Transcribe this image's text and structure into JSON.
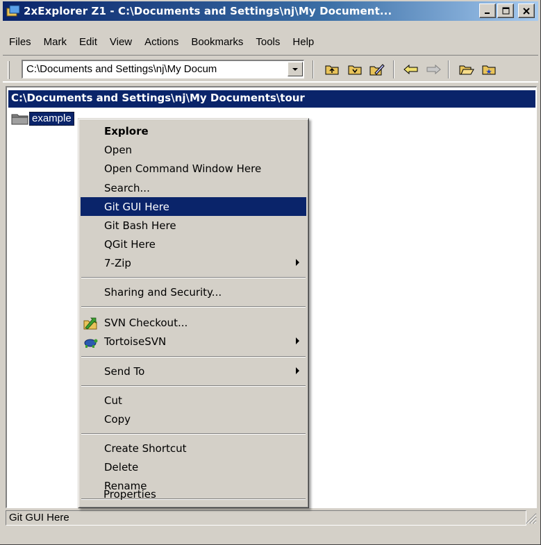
{
  "window": {
    "title": "2xExplorer Z1 - C:\\Documents and Settings\\nj\\My Document...",
    "app_icon": "2xexplorer-app-icon"
  },
  "menubar": {
    "items": [
      "Files",
      "Mark",
      "Edit",
      "View",
      "Actions",
      "Bookmarks",
      "Tools",
      "Help"
    ]
  },
  "toolbar": {
    "path_value": "C:\\Documents and Settings\\nj\\My Docum",
    "icons": [
      "up-folder-icon",
      "root-folder-icon",
      "edit-folder-icon",
      "back-icon",
      "forward-icon",
      "open-folder-icon",
      "bookmark-folder-icon"
    ]
  },
  "pane": {
    "header": "C:\\Documents and Settings\\nj\\My Documents\\tour",
    "items": [
      {
        "name": "example",
        "icon": "folder-icon"
      }
    ]
  },
  "context_menu": {
    "items": [
      {
        "label": "Explore"
      },
      {
        "label": "Open"
      },
      {
        "label": "Open Command Window Here"
      },
      {
        "label": "Search..."
      },
      {
        "label": "Git GUI Here"
      },
      {
        "label": "Git Bash Here"
      },
      {
        "label": "QGit Here"
      },
      {
        "label": "7-Zip"
      },
      {
        "label": "Sharing and Security..."
      },
      {
        "label": "SVN Checkout..."
      },
      {
        "label": "TortoiseSVN"
      },
      {
        "label": "Send To"
      },
      {
        "label": "Cut"
      },
      {
        "label": "Copy"
      },
      {
        "label": "Create Shortcut"
      },
      {
        "label": "Delete"
      },
      {
        "label": "Rename"
      },
      {
        "label": "Properties"
      }
    ],
    "highlighted": "Git GUI Here"
  },
  "statusbar": {
    "text": "Git GUI Here"
  },
  "colors": {
    "title_start": "#0a246a",
    "title_end": "#a6caf0",
    "highlight": "#0a246a",
    "face": "#d4d0c8"
  }
}
